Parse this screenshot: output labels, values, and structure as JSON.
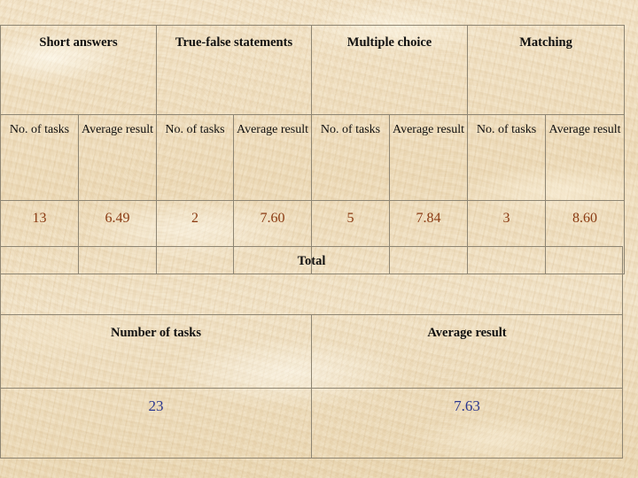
{
  "background": {
    "style": "parchment-texture",
    "base_color": "#eeddc0"
  },
  "colors": {
    "heading_text": "#101010",
    "detail_value_text": "#8a3a12",
    "total_value_text": "#2a378f",
    "table_border": "#8d8573"
  },
  "detail_table": {
    "group_headers": [
      "Short answers",
      "True-false statements",
      "Multiple choice",
      "Matching"
    ],
    "sub_headers": [
      "No. of tasks",
      "Average result",
      "No. of tasks",
      "Average result",
      "No. of tasks",
      "Average result",
      "No. of tasks",
      "Average result"
    ],
    "values": [
      "13",
      "6.49",
      "2",
      "7.60",
      "5",
      "7.84",
      "3",
      "8.60"
    ]
  },
  "total_table": {
    "caption": "Total",
    "headers": [
      "Number of tasks",
      "Average result"
    ],
    "values": [
      "23",
      "7.63"
    ]
  },
  "chart_data": {
    "type": "table",
    "title": "Task results by question type",
    "categories": [
      "Short answers",
      "True-false statements",
      "Multiple choice",
      "Matching"
    ],
    "series": [
      {
        "name": "No. of tasks",
        "values": [
          13,
          2,
          5,
          3
        ]
      },
      {
        "name": "Average result",
        "values": [
          6.49,
          7.6,
          7.84,
          8.6
        ]
      }
    ],
    "totals": {
      "Number of tasks": 23,
      "Average result": 7.63
    }
  }
}
